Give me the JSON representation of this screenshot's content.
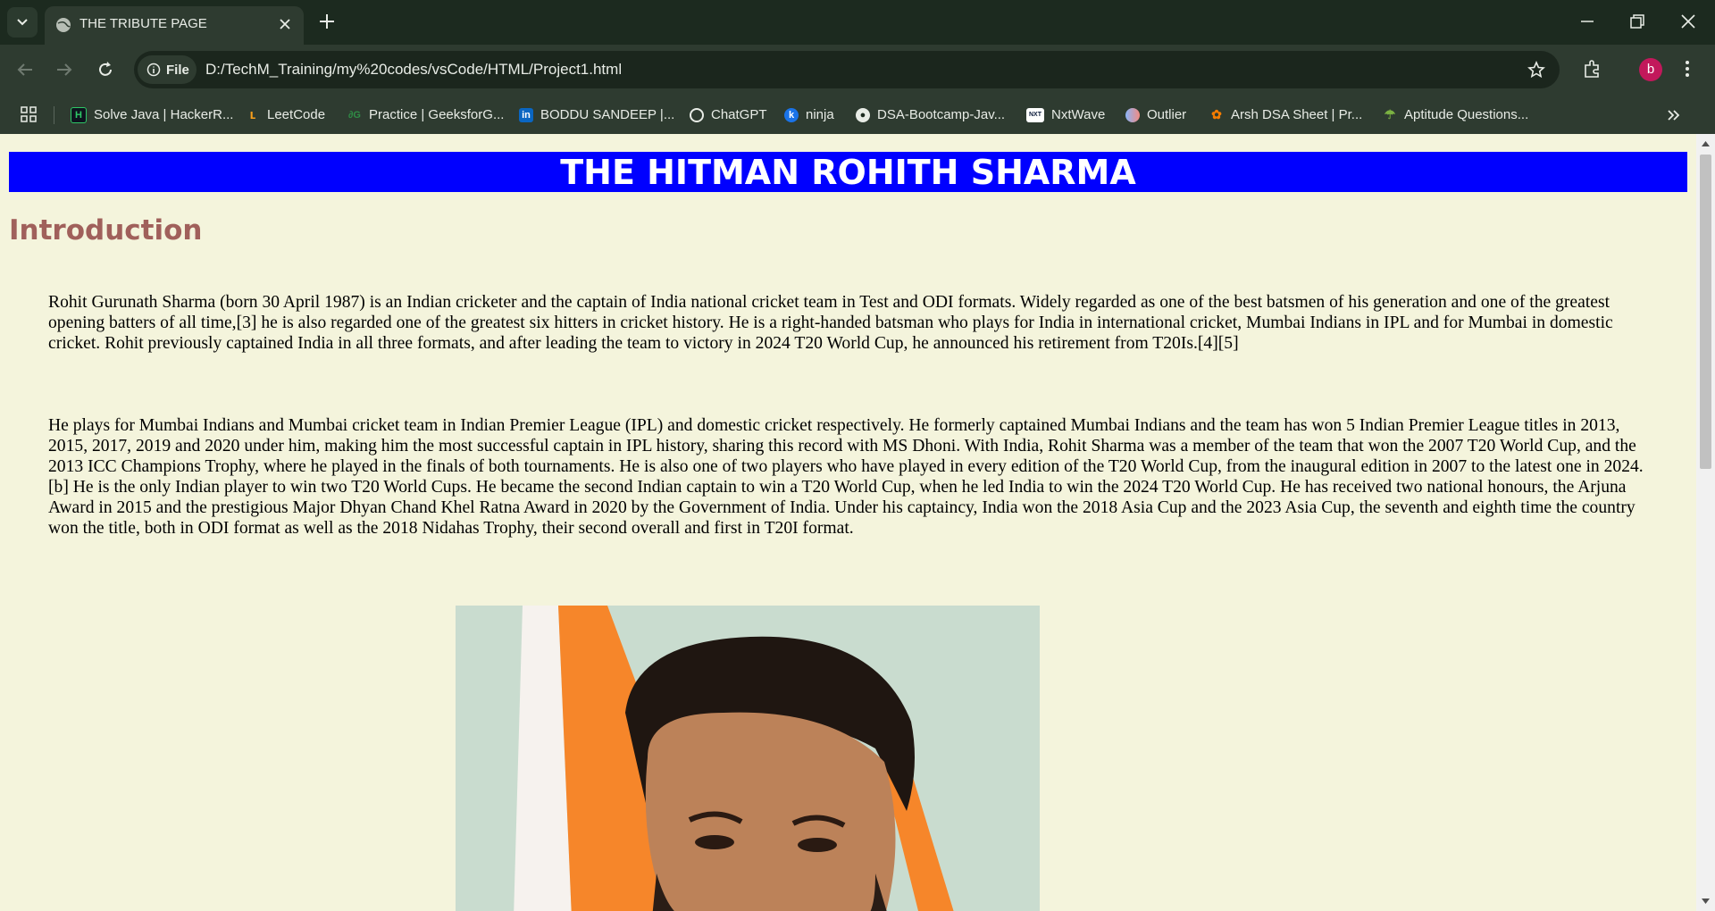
{
  "browser": {
    "tab_title": "THE TRIBUTE PAGE",
    "chip_label": "File",
    "url": "D:/TechM_Training/my%20codes/vsCode/HTML/Project1.html",
    "avatar_letter": "b",
    "accent_color": "#c2185b"
  },
  "bookmarks": [
    {
      "label": "Solve Java | HackerR...",
      "icon": "hackerrank-icon"
    },
    {
      "label": "LeetCode",
      "icon": "leetcode-icon"
    },
    {
      "label": "Practice | GeeksforG...",
      "icon": "geeksforgeeks-icon"
    },
    {
      "label": "BODDU SANDEEP |...",
      "icon": "linkedin-icon"
    },
    {
      "label": "ChatGPT",
      "icon": "chatgpt-icon"
    },
    {
      "label": "ninja",
      "icon": "ninja-icon"
    },
    {
      "label": "DSA-Bootcamp-Jav...",
      "icon": "github-icon"
    },
    {
      "label": "NxtWave",
      "icon": "nxtwave-icon"
    },
    {
      "label": "Outlier",
      "icon": "outlier-icon"
    },
    {
      "label": "Arsh DSA Sheet | Pr...",
      "icon": "arsh-icon"
    },
    {
      "label": "Aptitude Questions...",
      "icon": "aptitude-icon"
    }
  ],
  "page": {
    "banner": "THE HITMAN ROHITH SHARMA",
    "banner_color": "#0000ff",
    "heading": "Introduction",
    "heading_color": "#a0605b",
    "background_color": "#f4f4dc",
    "paragraph1": "Rohit Gurunath Sharma (born 30 April 1987) is an Indian cricketer and the captain of India national cricket team in Test and ODI formats. Widely regarded as one of the best batsmen of his generation and one of the greatest opening batters of all time,[3] he is also regarded one of the greatest six hitters in cricket history. He is a right-handed batsman who plays for India in international cricket, Mumbai Indians in IPL and for Mumbai in domestic cricket. Rohit previously captained India in all three formats, and after leading the team to victory in 2024 T20 World Cup, he announced his retirement from T20Is.[4][5]",
    "paragraph2": "He plays for Mumbai Indians and Mumbai cricket team in Indian Premier League (IPL) and domestic cricket respectively. He formerly captained Mumbai Indians and the team has won 5 Indian Premier League titles in 2013, 2015, 2017, 2019 and 2020 under him, making him the most successful captain in IPL history, sharing this record with MS Dhoni. With India, Rohit Sharma was a member of the team that won the 2007 T20 World Cup, and the 2013 ICC Champions Trophy, where he played in the finals of both tournaments. He is also one of two players who have played in every edition of the T20 World Cup, from the inaugural edition in 2007 to the latest one in 2024.[b] He is the only Indian player to win two T20 World Cups. He became the second Indian captain to win a T20 World Cup, when he led India to win the 2024 T20 World Cup. He has received two national honours, the Arjuna Award in 2015 and the prestigious Major Dhyan Chand Khel Ratna Award in 2020 by the Government of India. Under his captaincy, India won the 2018 Asia Cup and the 2023 Asia Cup, the seventh and eighth time the country won the title, both in ODI format as well as the 2018 Nidahas Trophy, their second overall and first in T20I format."
  }
}
